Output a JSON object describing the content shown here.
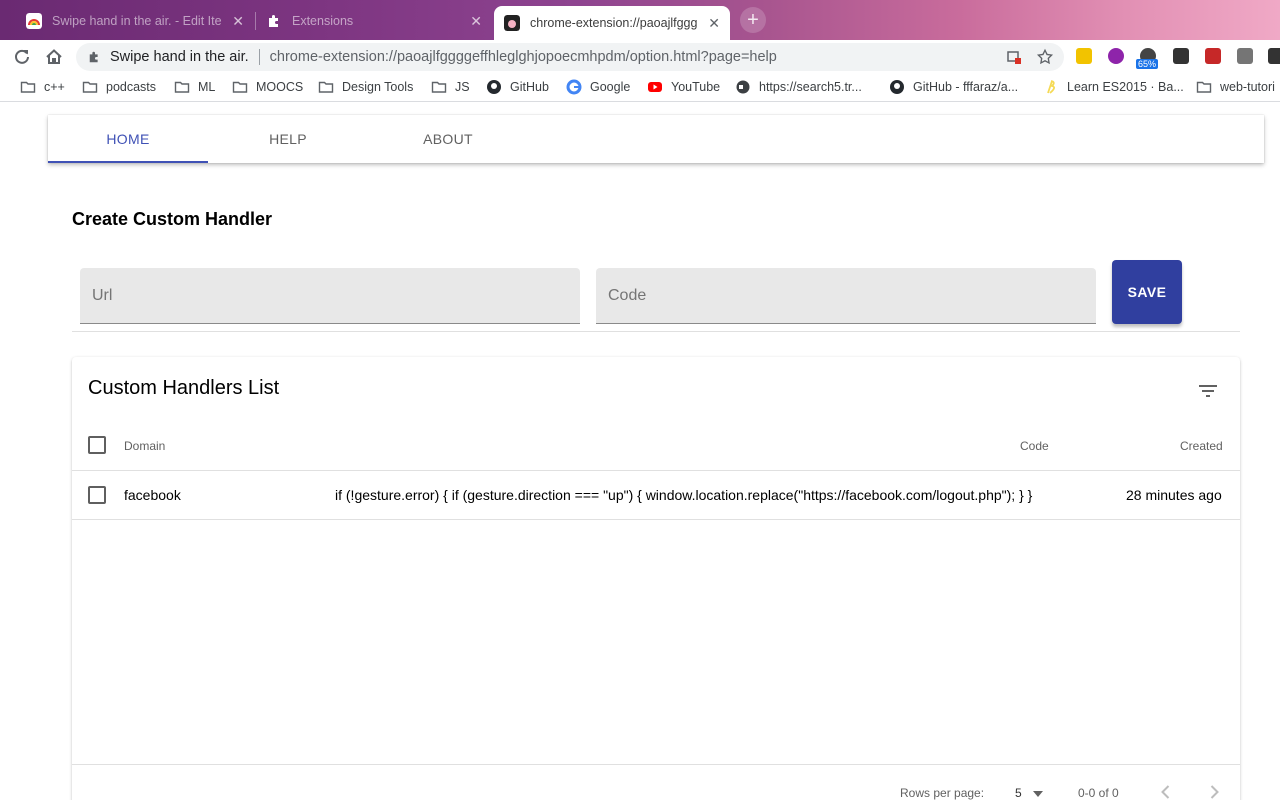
{
  "browser": {
    "tabs": [
      {
        "title": "Swipe hand in the air. - Edit Ite",
        "active": false
      },
      {
        "title": "Extensions",
        "active": false
      },
      {
        "title": "chrome-extension://paoajlfggg",
        "active": true
      }
    ],
    "omnibox": {
      "site_name": "Swipe hand in the air.",
      "url": "chrome-extension://paoajlfggggeffhleglghjopoecmhpdm/option.html?page=help"
    },
    "extension_badge": "65%",
    "bookmarks": [
      "c++",
      "podcasts",
      "ML",
      "MOOCS",
      "Design Tools",
      "JS",
      "GitHub",
      "Google",
      "YouTube",
      "https://search5.tr...",
      "GitHub - fffaraz/a...",
      "Learn ES2015 · Ba...",
      "web-tutori"
    ]
  },
  "nav": {
    "tabs": [
      "HOME",
      "HELP",
      "ABOUT"
    ],
    "active_index": 0
  },
  "form": {
    "title": "Create Custom Handler",
    "url_placeholder": "Url",
    "code_placeholder": "Code",
    "save_label": "SAVE"
  },
  "table": {
    "title": "Custom Handlers List",
    "columns": {
      "domain": "Domain",
      "code": "Code",
      "created": "Created"
    },
    "rows": [
      {
        "domain": "facebook",
        "code": "if (!gesture.error) { if (gesture.direction === \"up\") { window.location.replace(\"https://facebook.com/logout.php\"); } }",
        "created": "28 minutes ago"
      }
    ],
    "footer": {
      "rows_per_page_label": "Rows per page:",
      "rows_per_page_value": "5",
      "range": "0-0 of 0"
    }
  },
  "colors": {
    "primary": "#3f51b5",
    "save_button": "#303f9f",
    "field_background": "#e8e8e8"
  }
}
